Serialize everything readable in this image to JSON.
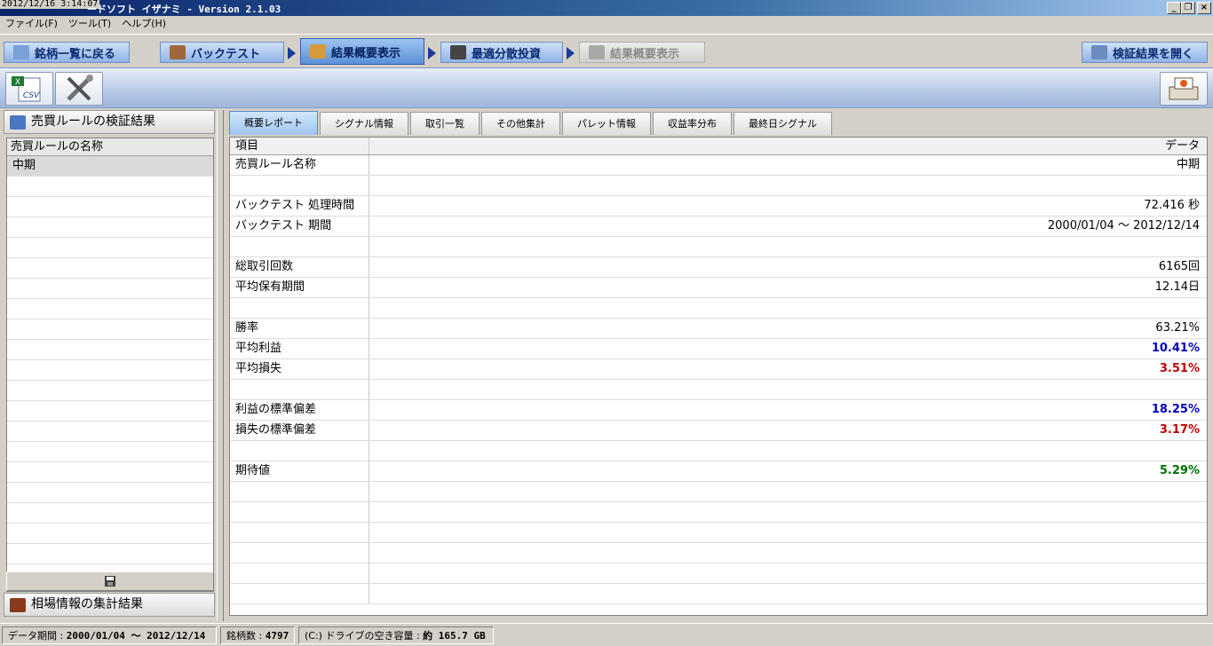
{
  "window": {
    "timestamp": "2012/12/16 3:14:07",
    "title": "ードソフト イザナミ - Version 2.1.03",
    "minimize": "_",
    "restore": "❐",
    "close": "×"
  },
  "menu": [
    "ファイル(F)",
    "ツール(T)",
    "ヘルプ(H)"
  ],
  "steps": {
    "back": "銘柄一覧に戻る",
    "backtest": "バックテスト",
    "summary": "結果概要表示",
    "optimal": "最適分散投資",
    "summary2": "結果概要表示",
    "open": "検証結果を開く"
  },
  "toolbar": {
    "csv_label": "CSV"
  },
  "left": {
    "header": "売買ルールの検証結果",
    "list_header": "売買ルールの名称",
    "rules": [
      "中期"
    ],
    "bottom_header": "相場情報の集計結果"
  },
  "tabs": [
    "概要レポート",
    "シグナル情報",
    "取引一覧",
    "その他集計",
    "パレット情報",
    "収益率分布",
    "最終日シグナル"
  ],
  "report": {
    "col_item": "項目",
    "col_data": "データ",
    "rows": [
      {
        "item": "売買ルール名称",
        "value": "中期",
        "color": "normal"
      },
      {
        "item": "",
        "value": "",
        "color": "normal"
      },
      {
        "item": "バックテスト 処理時間",
        "value": "72.416 秒",
        "color": "normal"
      },
      {
        "item": "バックテスト 期間",
        "value": "2000/01/04 ～ 2012/12/14",
        "color": "normal"
      },
      {
        "item": "",
        "value": "",
        "color": "normal"
      },
      {
        "item": "総取引回数",
        "value": "6165回",
        "color": "normal"
      },
      {
        "item": "平均保有期間",
        "value": "12.14日",
        "color": "normal"
      },
      {
        "item": "",
        "value": "",
        "color": "normal"
      },
      {
        "item": "勝率",
        "value": "63.21%",
        "color": "normal"
      },
      {
        "item": "平均利益",
        "value": "10.41%",
        "color": "blue"
      },
      {
        "item": "平均損失",
        "value": "3.51%",
        "color": "red"
      },
      {
        "item": "",
        "value": "",
        "color": "normal"
      },
      {
        "item": "利益の標準偏差",
        "value": "18.25%",
        "color": "blue"
      },
      {
        "item": "損失の標準偏差",
        "value": "3.17%",
        "color": "red"
      },
      {
        "item": "",
        "value": "",
        "color": "normal"
      },
      {
        "item": "期待値",
        "value": "5.29%",
        "color": "green"
      }
    ]
  },
  "status": {
    "period_label": "データ期間 : ",
    "period_value": "2000/01/04 ～ 2012/12/14",
    "count_label": "銘柄数 : ",
    "count_value": "4797",
    "disk_label": "(C:) ドライブの空き容量 : ",
    "disk_value": "約 165.7 GB"
  },
  "colors": {
    "blue": "#0000c0",
    "red": "#c00000",
    "green": "#007000",
    "step_active": "#5b8fd8"
  }
}
